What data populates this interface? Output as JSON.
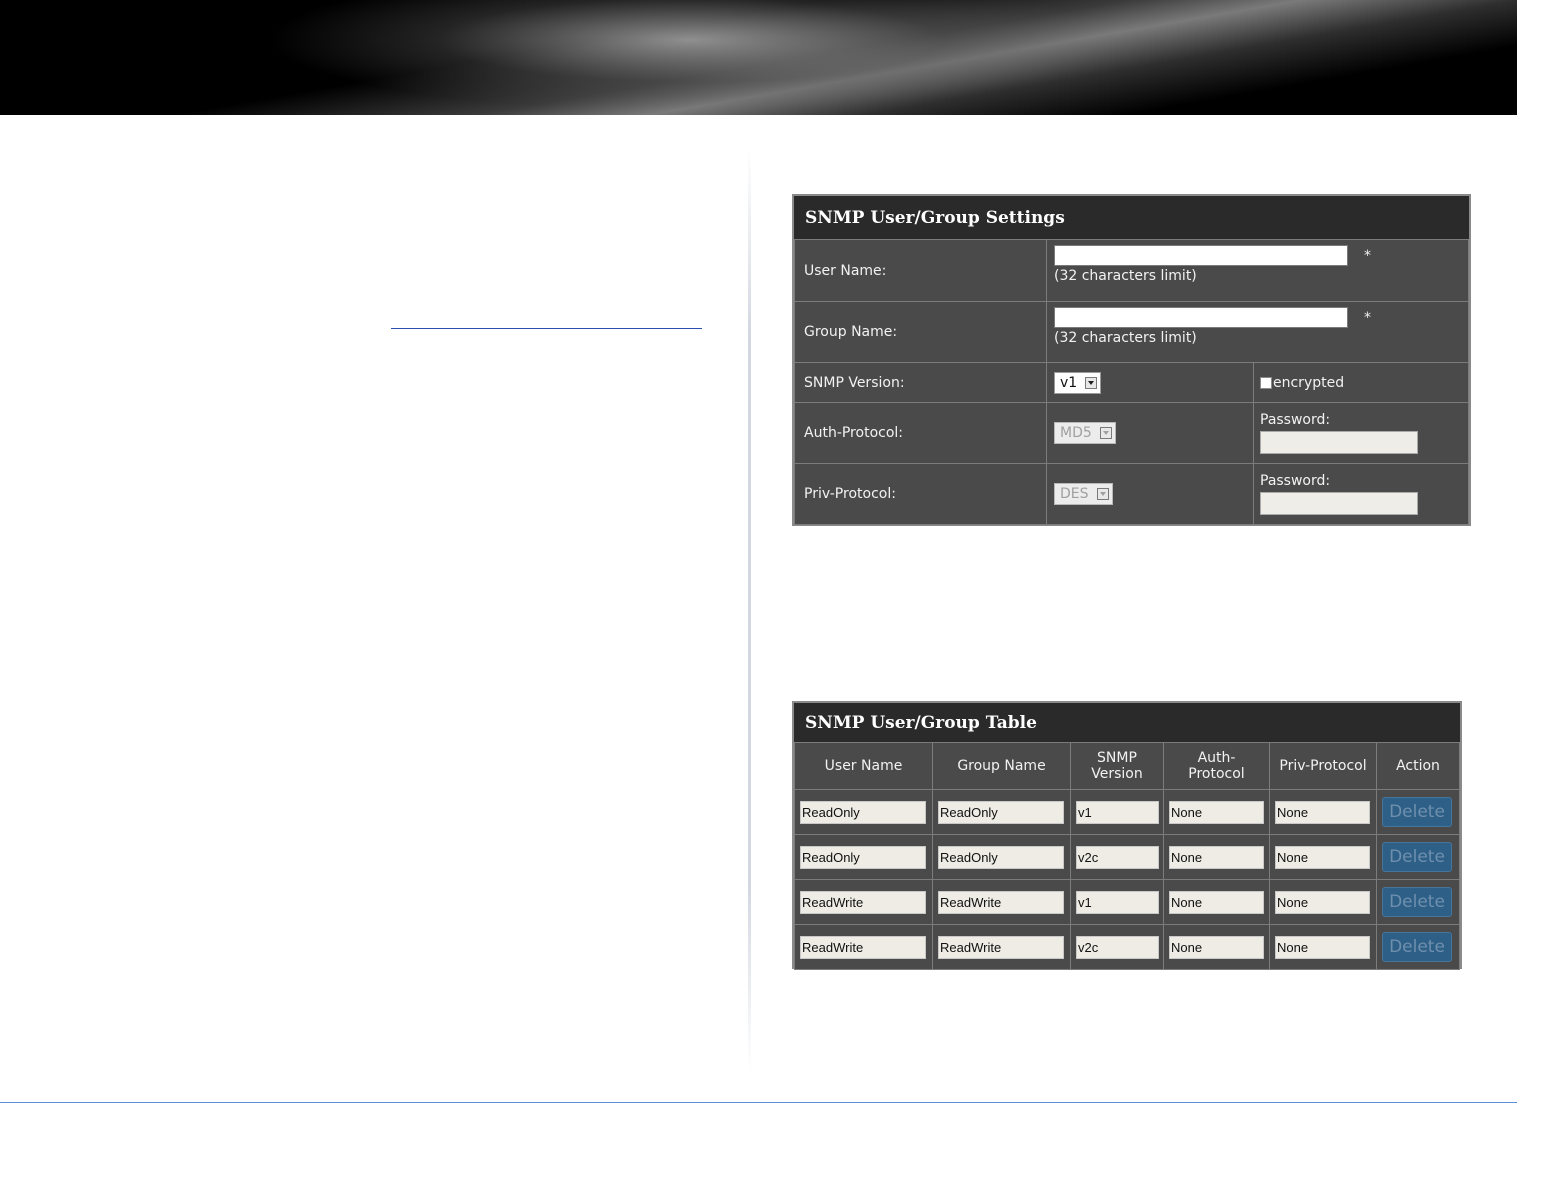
{
  "settings": {
    "title": "SNMP User/Group Settings",
    "user_name_label": "User Name:",
    "user_name_value": "",
    "user_name_hint": "(32 characters limit)",
    "group_name_label": "Group Name:",
    "group_name_value": "",
    "group_name_hint": "(32 characters limit)",
    "required_mark": "*",
    "snmp_version_label": "SNMP Version:",
    "snmp_version_value": "v1",
    "encrypted_label": "encrypted",
    "auth_protocol_label": "Auth-Protocol:",
    "auth_protocol_value": "MD5",
    "auth_password_label": "Password:",
    "priv_protocol_label": "Priv-Protocol:",
    "priv_protocol_value": "DES",
    "priv_password_label": "Password:"
  },
  "table": {
    "title": "SNMP User/Group Table",
    "headers": {
      "user_name": "User Name",
      "group_name": "Group Name",
      "snmp_version": "SNMP Version",
      "auth_protocol": "Auth-Protocol",
      "priv_protocol": "Priv-Protocol",
      "action": "Action"
    },
    "delete_label": "Delete",
    "rows": [
      {
        "user_name": "ReadOnly",
        "group_name": "ReadOnly",
        "snmp_version": "v1",
        "auth_protocol": "None",
        "priv_protocol": "None"
      },
      {
        "user_name": "ReadOnly",
        "group_name": "ReadOnly",
        "snmp_version": "v2c",
        "auth_protocol": "None",
        "priv_protocol": "None"
      },
      {
        "user_name": "ReadWrite",
        "group_name": "ReadWrite",
        "snmp_version": "v1",
        "auth_protocol": "None",
        "priv_protocol": "None"
      },
      {
        "user_name": "ReadWrite",
        "group_name": "ReadWrite",
        "snmp_version": "v2c",
        "auth_protocol": "None",
        "priv_protocol": "None"
      }
    ]
  }
}
